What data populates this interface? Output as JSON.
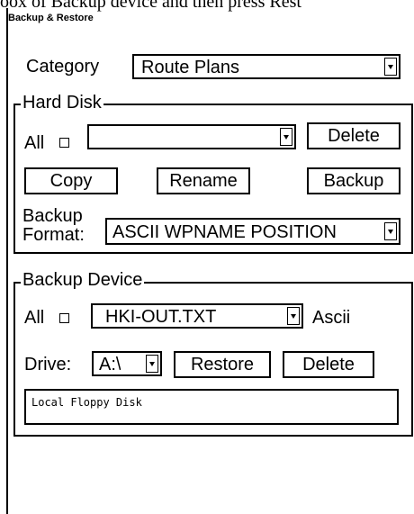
{
  "top_cut_text": "oox of Backup device and then  press Rest",
  "window": {
    "title": "Backup & Restore"
  },
  "category": {
    "label": "Category",
    "value": "Route Plans"
  },
  "hard_disk": {
    "legend": "Hard Disk",
    "all_label": "All",
    "file_value": "",
    "delete_label": "Delete",
    "copy_label": "Copy",
    "rename_label": "Rename",
    "backup_label": "Backup",
    "backup_format_label_line1": "Backup",
    "backup_format_label_line2": "Format:",
    "backup_format_value": "ASCII WPNAME POSITION"
  },
  "backup_device": {
    "legend": "Backup Device",
    "all_label": "All",
    "file_value": "HKI-OUT.TXT",
    "ascii_label": "Ascii",
    "drive_label": "Drive:",
    "drive_value": "A:\\",
    "restore_label": "Restore",
    "delete_label": "Delete",
    "status_text": "Local Floppy Disk"
  }
}
